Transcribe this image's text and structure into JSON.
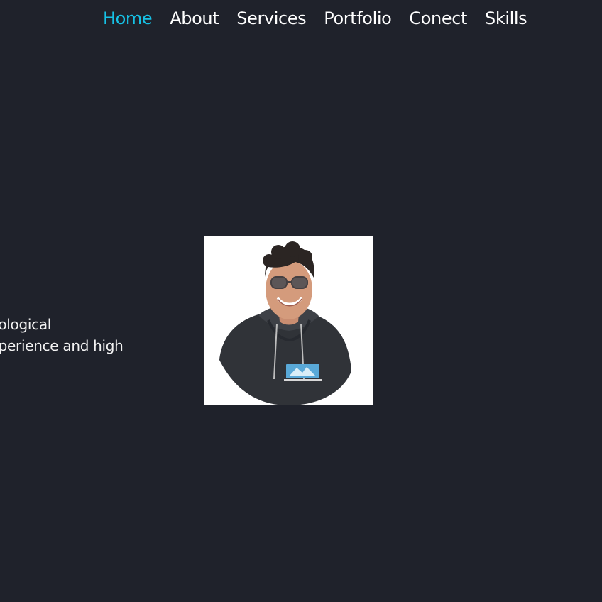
{
  "theme": {
    "background": "#1f222b",
    "accent": "#16c2e6",
    "text": "#ffffff"
  },
  "nav": {
    "items": [
      {
        "label": "Home",
        "active": true
      },
      {
        "label": "About",
        "active": false
      },
      {
        "label": "Services",
        "active": false
      },
      {
        "label": "Portfolio",
        "active": false
      },
      {
        "label": "Conect",
        "active": false
      },
      {
        "label": "Skills",
        "active": false
      }
    ]
  },
  "hero": {
    "line1": "ative technological",
    "line2": "ent user experience and high"
  },
  "profile": {
    "image": "profile-photo"
  }
}
